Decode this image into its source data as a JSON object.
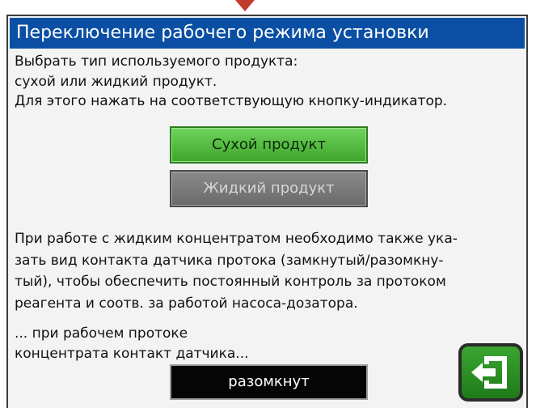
{
  "dialog": {
    "title": "Переключение рабочего режима установки",
    "intro": [
      "Выбрать тип используемого продукта:",
      "сухой или жидкий продукт.",
      "Для этого нажать на соответствующую кнопку-индикатор."
    ],
    "buttons": {
      "dry_product": "Сухой продукт",
      "liquid_product": "Жидкий продукт",
      "contact_state": "разомкнут"
    },
    "info": [
      "При работе с жидким концентратом необходимо также ука-",
      "зать вид контакта датчика протока (замкнутый/разомкну-",
      "тый), чтобы обеспечить постоянный контроль за протоком",
      "реагента и соотв. за работой насоса-дозатора."
    ],
    "contact_label": [
      "... при рабочем протоке",
      "концентрата контакт датчика..."
    ],
    "icons": {
      "exit": "exit-icon",
      "top_marker": "arrow-down-marker-icon"
    },
    "colors": {
      "title_bar": "#0a4fa3",
      "dry_active": "#4caf3a",
      "liquid_inactive": "#7a7a7a",
      "contact_button": "#050505",
      "exit_button": "#2e9028"
    }
  }
}
